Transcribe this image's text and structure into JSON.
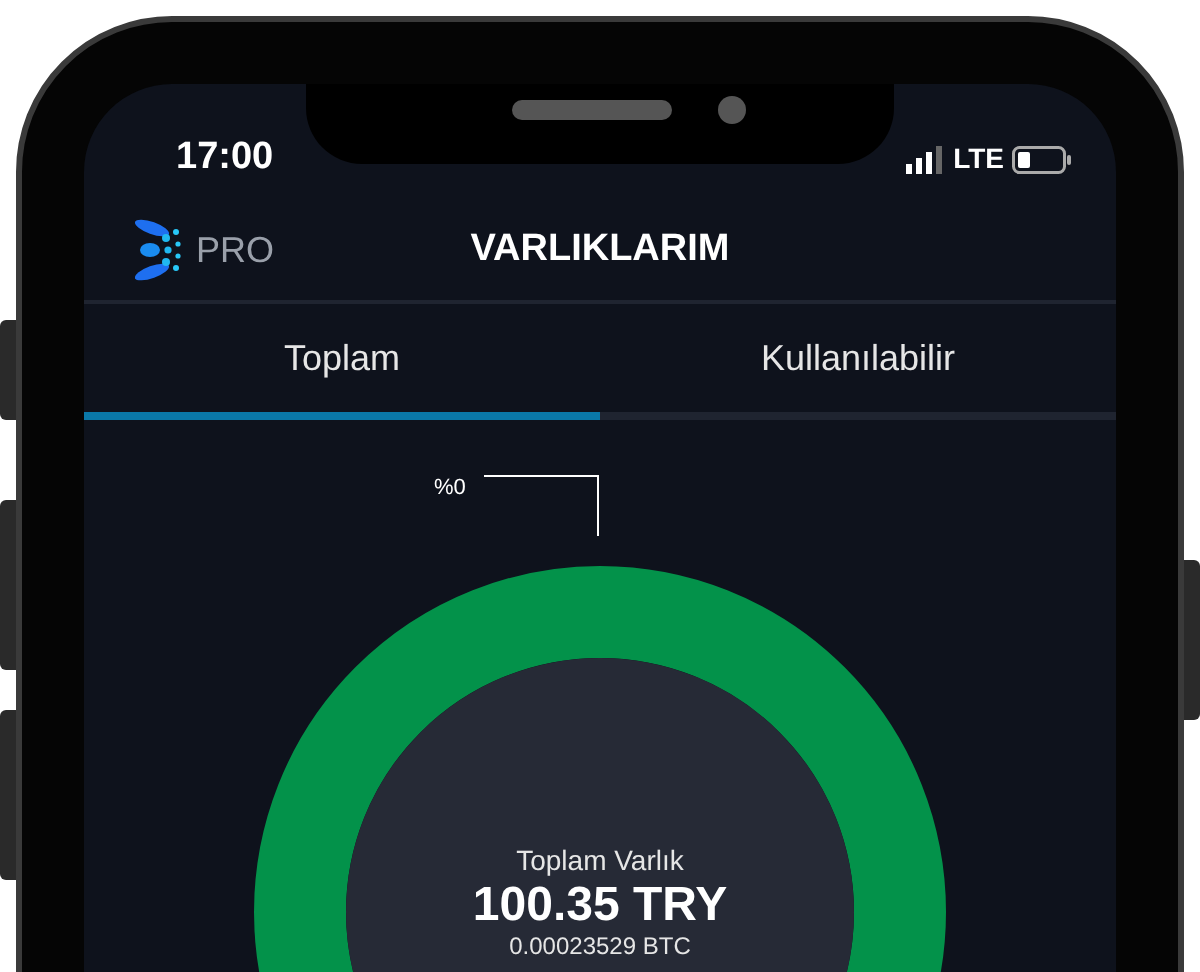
{
  "status_bar": {
    "time": "17:00",
    "network": "LTE"
  },
  "header": {
    "brand": "PRO",
    "title": "VARLIKLARIM"
  },
  "tabs": [
    {
      "label": "Toplam",
      "selected": true
    },
    {
      "label": "Kullanılabilir",
      "selected": false
    }
  ],
  "chart": {
    "slice_label": "%0",
    "center_title": "Toplam Varlık",
    "total": "100.35 TRY",
    "total_btc": "0.00023529 BTC"
  }
}
